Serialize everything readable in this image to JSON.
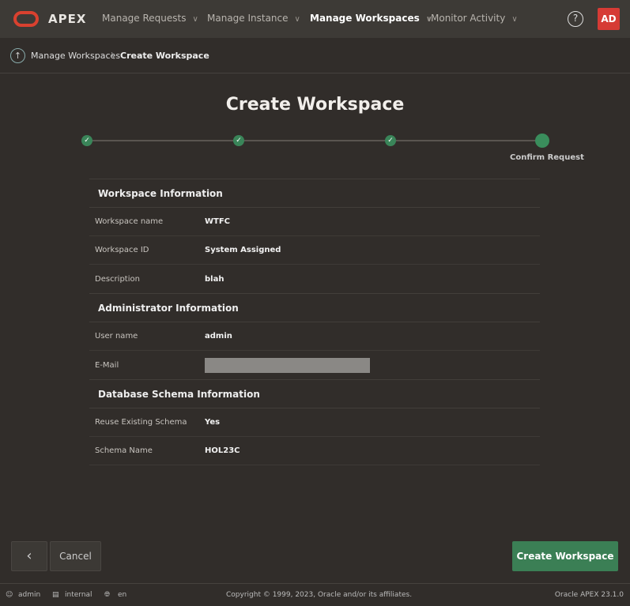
{
  "header": {
    "brand": "APEX",
    "nav": [
      {
        "label": "Manage Requests",
        "active": false
      },
      {
        "label": "Manage Instance",
        "active": false
      },
      {
        "label": "Manage Workspaces",
        "active": true
      },
      {
        "label": "Monitor Activity",
        "active": false
      }
    ],
    "help": "?",
    "avatar": "AD"
  },
  "breadcrumb": {
    "parent": "Manage Workspaces",
    "separator": "\\",
    "current": "Create Workspace"
  },
  "page_title": "Create Workspace",
  "wizard": {
    "steps_completed": 3,
    "total_steps": 4,
    "current_label": "Confirm Request"
  },
  "sections": [
    {
      "title": "Workspace Information",
      "rows": [
        {
          "label": "Workspace name",
          "value": "WTFC"
        },
        {
          "label": "Workspace ID",
          "value": "System Assigned"
        },
        {
          "label": "Description",
          "value": "blah"
        }
      ]
    },
    {
      "title": "Administrator Information",
      "rows": [
        {
          "label": "User name",
          "value": "admin"
        },
        {
          "label": "E-Mail",
          "value": ""
        }
      ]
    },
    {
      "title": "Database Schema Information",
      "rows": [
        {
          "label": "Reuse Existing Schema",
          "value": "Yes"
        },
        {
          "label": "Schema Name",
          "value": "HOL23C"
        }
      ]
    }
  ],
  "buttons": {
    "back": "‹",
    "cancel": "Cancel",
    "create": "Create Workspace"
  },
  "footer": {
    "user": "admin",
    "workspace": "internal",
    "language": "en",
    "copyright": "Copyright © 1999, 2023, Oracle and/or its affiliates.",
    "version": "Oracle APEX 23.1.0"
  },
  "colors": {
    "accent": "#3b7f55",
    "brand": "#d9412f",
    "background": "#312d2a"
  }
}
